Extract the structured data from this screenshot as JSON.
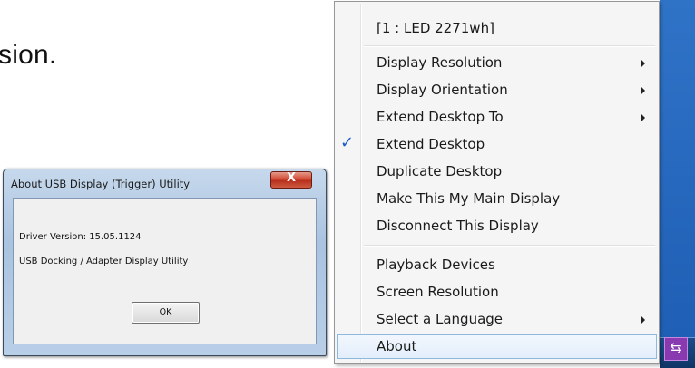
{
  "background_text": "sion.",
  "dialog": {
    "title": "About USB Display (Trigger) Utility",
    "close_label": "X",
    "driver_version": "Driver Version: 15.05.1124",
    "utility_name": "USB Docking / Adapter Display Utility",
    "ok_label": "OK"
  },
  "menu": {
    "items": [
      {
        "label": "[1 : LED 2271wh]",
        "submenu": false,
        "checked": false
      },
      {
        "label": "Display Resolution",
        "submenu": true,
        "checked": false
      },
      {
        "label": "Display Orientation",
        "submenu": true,
        "checked": false
      },
      {
        "label": "Extend Desktop To",
        "submenu": true,
        "checked": false
      },
      {
        "label": "Extend Desktop",
        "submenu": false,
        "checked": true
      },
      {
        "label": "Duplicate Desktop",
        "submenu": false,
        "checked": false
      },
      {
        "label": "Make This My Main Display",
        "submenu": false,
        "checked": false
      },
      {
        "label": "Disconnect This Display",
        "submenu": false,
        "checked": false
      },
      {
        "label": "Playback Devices",
        "submenu": false,
        "checked": false
      },
      {
        "label": "Screen Resolution",
        "submenu": false,
        "checked": false
      },
      {
        "label": "Select a Language",
        "submenu": true,
        "checked": false
      },
      {
        "label": "About",
        "submenu": false,
        "checked": false,
        "highlighted": true
      }
    ],
    "check_glyph": "✓"
  },
  "tray": {
    "icon": "usb-display-icon",
    "glyph": "⇆"
  },
  "colors": {
    "desktop": "#2f73c7",
    "taskbar": "#0f3566",
    "check": "#1a5cc9",
    "close_button": "#d14a34"
  }
}
